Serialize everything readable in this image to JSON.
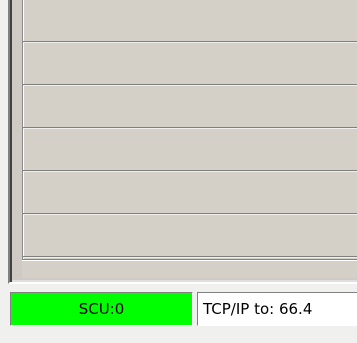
{
  "statusbar": {
    "scu_label": "SCU:0",
    "tcp_label": "TCP/IP to: 66.4",
    "scu_color": "#00ff00"
  },
  "grid": {
    "row_count": 5
  }
}
